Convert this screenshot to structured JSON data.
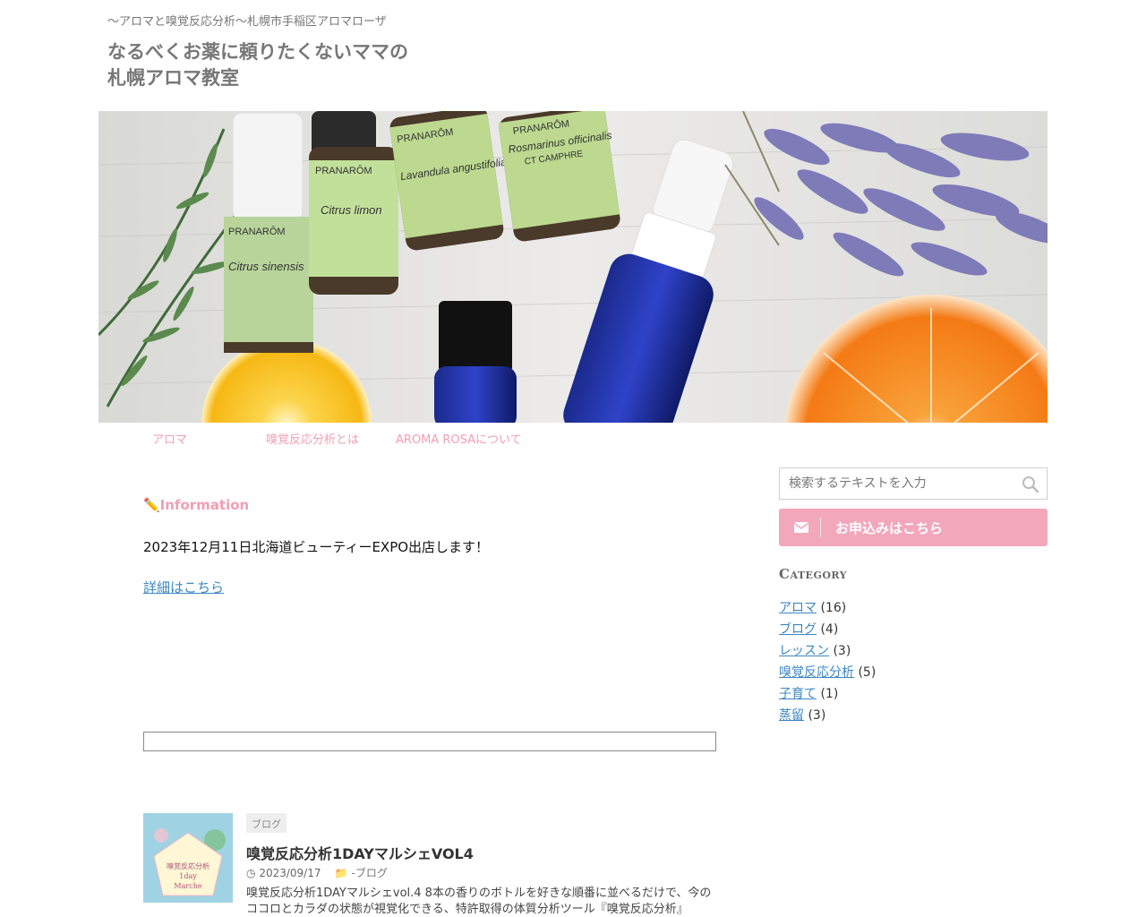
{
  "header": {
    "tagline": "〜アロマと嗅覚反応分析〜札幌市手稲区アロマローザ",
    "title_line1": "なるべくお薬に頼りたくないママの",
    "title_line2": "札幌アロマ教室"
  },
  "hero": {
    "bottle_brand": "PRANARÔM",
    "bottle_labels": [
      "Citrus sinensis",
      "Citrus limon",
      "Lavandula angustifolia",
      "Rosmarinus officinalis"
    ],
    "rosemary_sub": "CT CAMPHRE"
  },
  "nav": {
    "items": [
      "アロマ",
      "嗅覚反応分析とは",
      "AROMA ROSAについて"
    ]
  },
  "main": {
    "info_title": "✏️Information",
    "info_text": "2023年12月11日北海道ビューティーEXPO出店します！",
    "info_link": "詳細はこちら"
  },
  "post": {
    "category_badge": "ブログ",
    "title": "嗅覚反応分析1DAYマルシェVOL4",
    "date": "2023/09/17",
    "category_link": "-ブログ",
    "excerpt": "嗅覚反応分析1DAYマルシェvol.4 8本の香りのボトルを好きな順番に並べるだけで、今のココロとカラダの状態が視覚化できる、特許取得の体質分析ツール『嗅覚反応分析』",
    "thumb_text1": "嗅覚反応分析",
    "thumb_text2": "1day",
    "thumb_text3": "Marche"
  },
  "sidebar": {
    "search_placeholder": "検索するテキストを入力",
    "apply_label": "お申込みはこちら",
    "category_heading": "Category",
    "categories": [
      {
        "name": "アロマ",
        "count": "(16)"
      },
      {
        "name": "ブログ",
        "count": "(4)"
      },
      {
        "name": "レッスン",
        "count": "(3)"
      },
      {
        "name": "嗅覚反応分析",
        "count": "(5)"
      },
      {
        "name": "子育て",
        "count": "(1)"
      },
      {
        "name": "蒸留",
        "count": "(3)"
      }
    ]
  },
  "colors": {
    "accent_pink": "#f3a7bb",
    "link_blue": "#3c87c3"
  }
}
